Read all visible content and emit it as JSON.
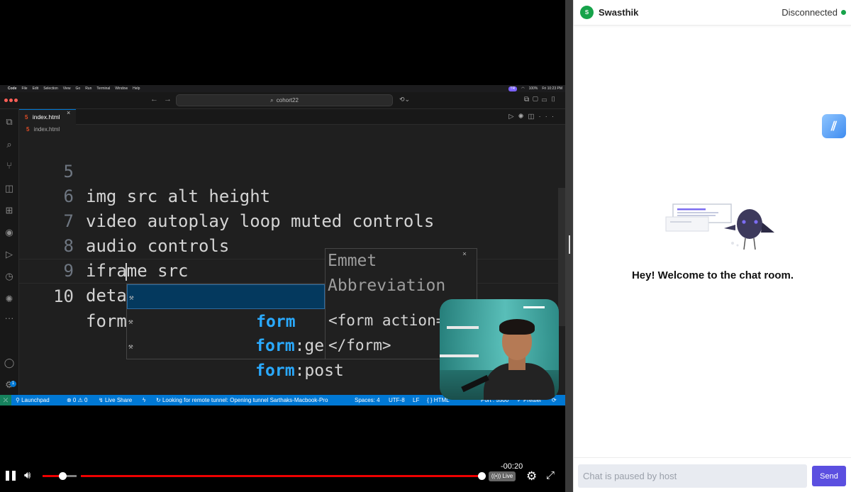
{
  "menubar": {
    "app": "Code",
    "items": [
      "File",
      "Edit",
      "Selection",
      "View",
      "Go",
      "Run",
      "Terminal",
      "Window",
      "Help"
    ],
    "status_right": "100%",
    "clock": "Fri 10:23 PM"
  },
  "vscode": {
    "command_center": "cohort22",
    "tab": {
      "name": "index.html"
    },
    "breadcrumb": "index.html",
    "lines": [
      {
        "num": "5",
        "text": "img src alt height"
      },
      {
        "num": "6",
        "text": "video autoplay loop muted controls"
      },
      {
        "num": "7",
        "text": "audio controls"
      },
      {
        "num": "8",
        "text": "iframe src"
      },
      {
        "num": "9",
        "text": "details summary"
      },
      {
        "num": "10",
        "text": "form"
      }
    ],
    "suggestions": [
      {
        "match": "form",
        "rest": ""
      },
      {
        "match": "form",
        "rest": ":get"
      },
      {
        "match": "form",
        "rest": ":post"
      }
    ],
    "details": {
      "title": "Emmet Abbreviation",
      "body_line1": "<form action=\"|\"",
      "body_line2": "</form>"
    },
    "statusbar": {
      "launchpad": "Launchpad",
      "problems": "⊗ 0 ⚠ 0",
      "live_share": "Live Share",
      "message": "Looking for remote tunnel: Opening tunnel Sarthaks-Macbook-Pro",
      "spaces": "Spaces: 4",
      "encoding": "UTF-8",
      "eol": "LF",
      "language": "{ } HTML",
      "port": "Port : 5500",
      "prettier": "Prettier"
    }
  },
  "player": {
    "time": "-00:20",
    "live_label": "Live",
    "volume_fraction": 0.6,
    "seek_fraction": 1.0
  },
  "chat": {
    "avatar_letter": "S",
    "username": "Swasthik",
    "connection_status": "Disconnected",
    "welcome": "Hey! Welcome to the chat room.",
    "input_placeholder": "Chat is paused by host",
    "send_label": "Send"
  },
  "colors": {
    "accent": "#0078d4",
    "send": "#5b4fe0",
    "status_online": "#16a34a",
    "progress": "#e00000"
  }
}
